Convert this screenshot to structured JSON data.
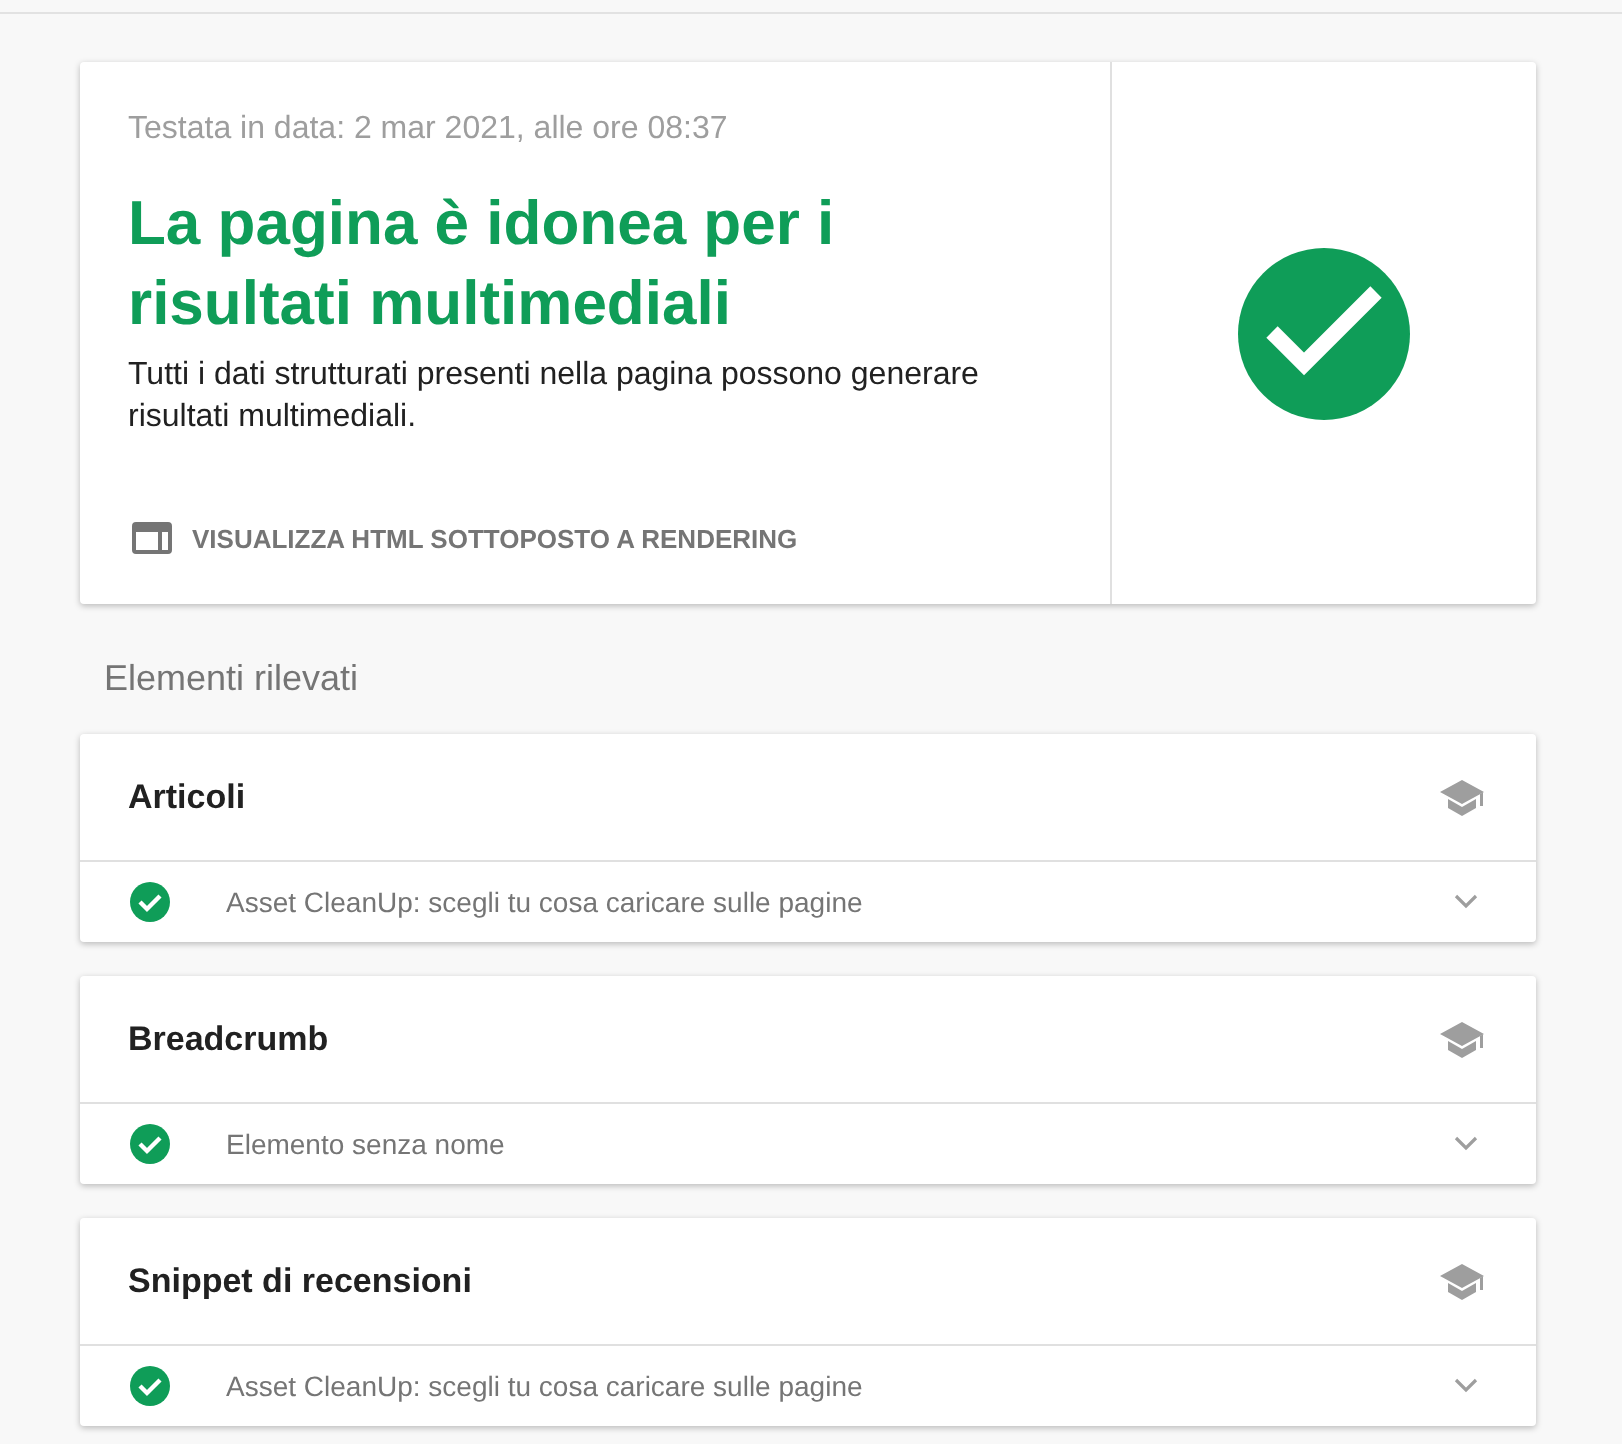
{
  "test_info": {
    "timestamp": "Testata in data: 2 mar 2021, alle ore 08:37"
  },
  "verdict": {
    "valid": true,
    "headline": "La pagina è idonea per i risultati multimediali",
    "description": "Tutti i dati strutturati presenti nella pagina possono generare risultati multimediali.",
    "action": "VISUALIZZA HTML SOTTOPOSTO A RENDERING"
  },
  "detected": {
    "heading": "Elementi rilevati",
    "types": [
      {
        "name": "Articoli",
        "items": [
          {
            "name": "Asset CleanUp: scegli tu cosa caricare sulle pagine",
            "valid": true,
            "expanded": false
          }
        ]
      },
      {
        "name": "Breadcrumb",
        "items": [
          {
            "name": "Elemento senza nome",
            "valid": true,
            "expanded": false
          }
        ]
      },
      {
        "name": "Snippet di recensioni",
        "items": [
          {
            "name": "Asset CleanUp: scegli tu cosa caricare sulle pagine",
            "valid": true,
            "expanded": false
          }
        ]
      }
    ]
  }
}
